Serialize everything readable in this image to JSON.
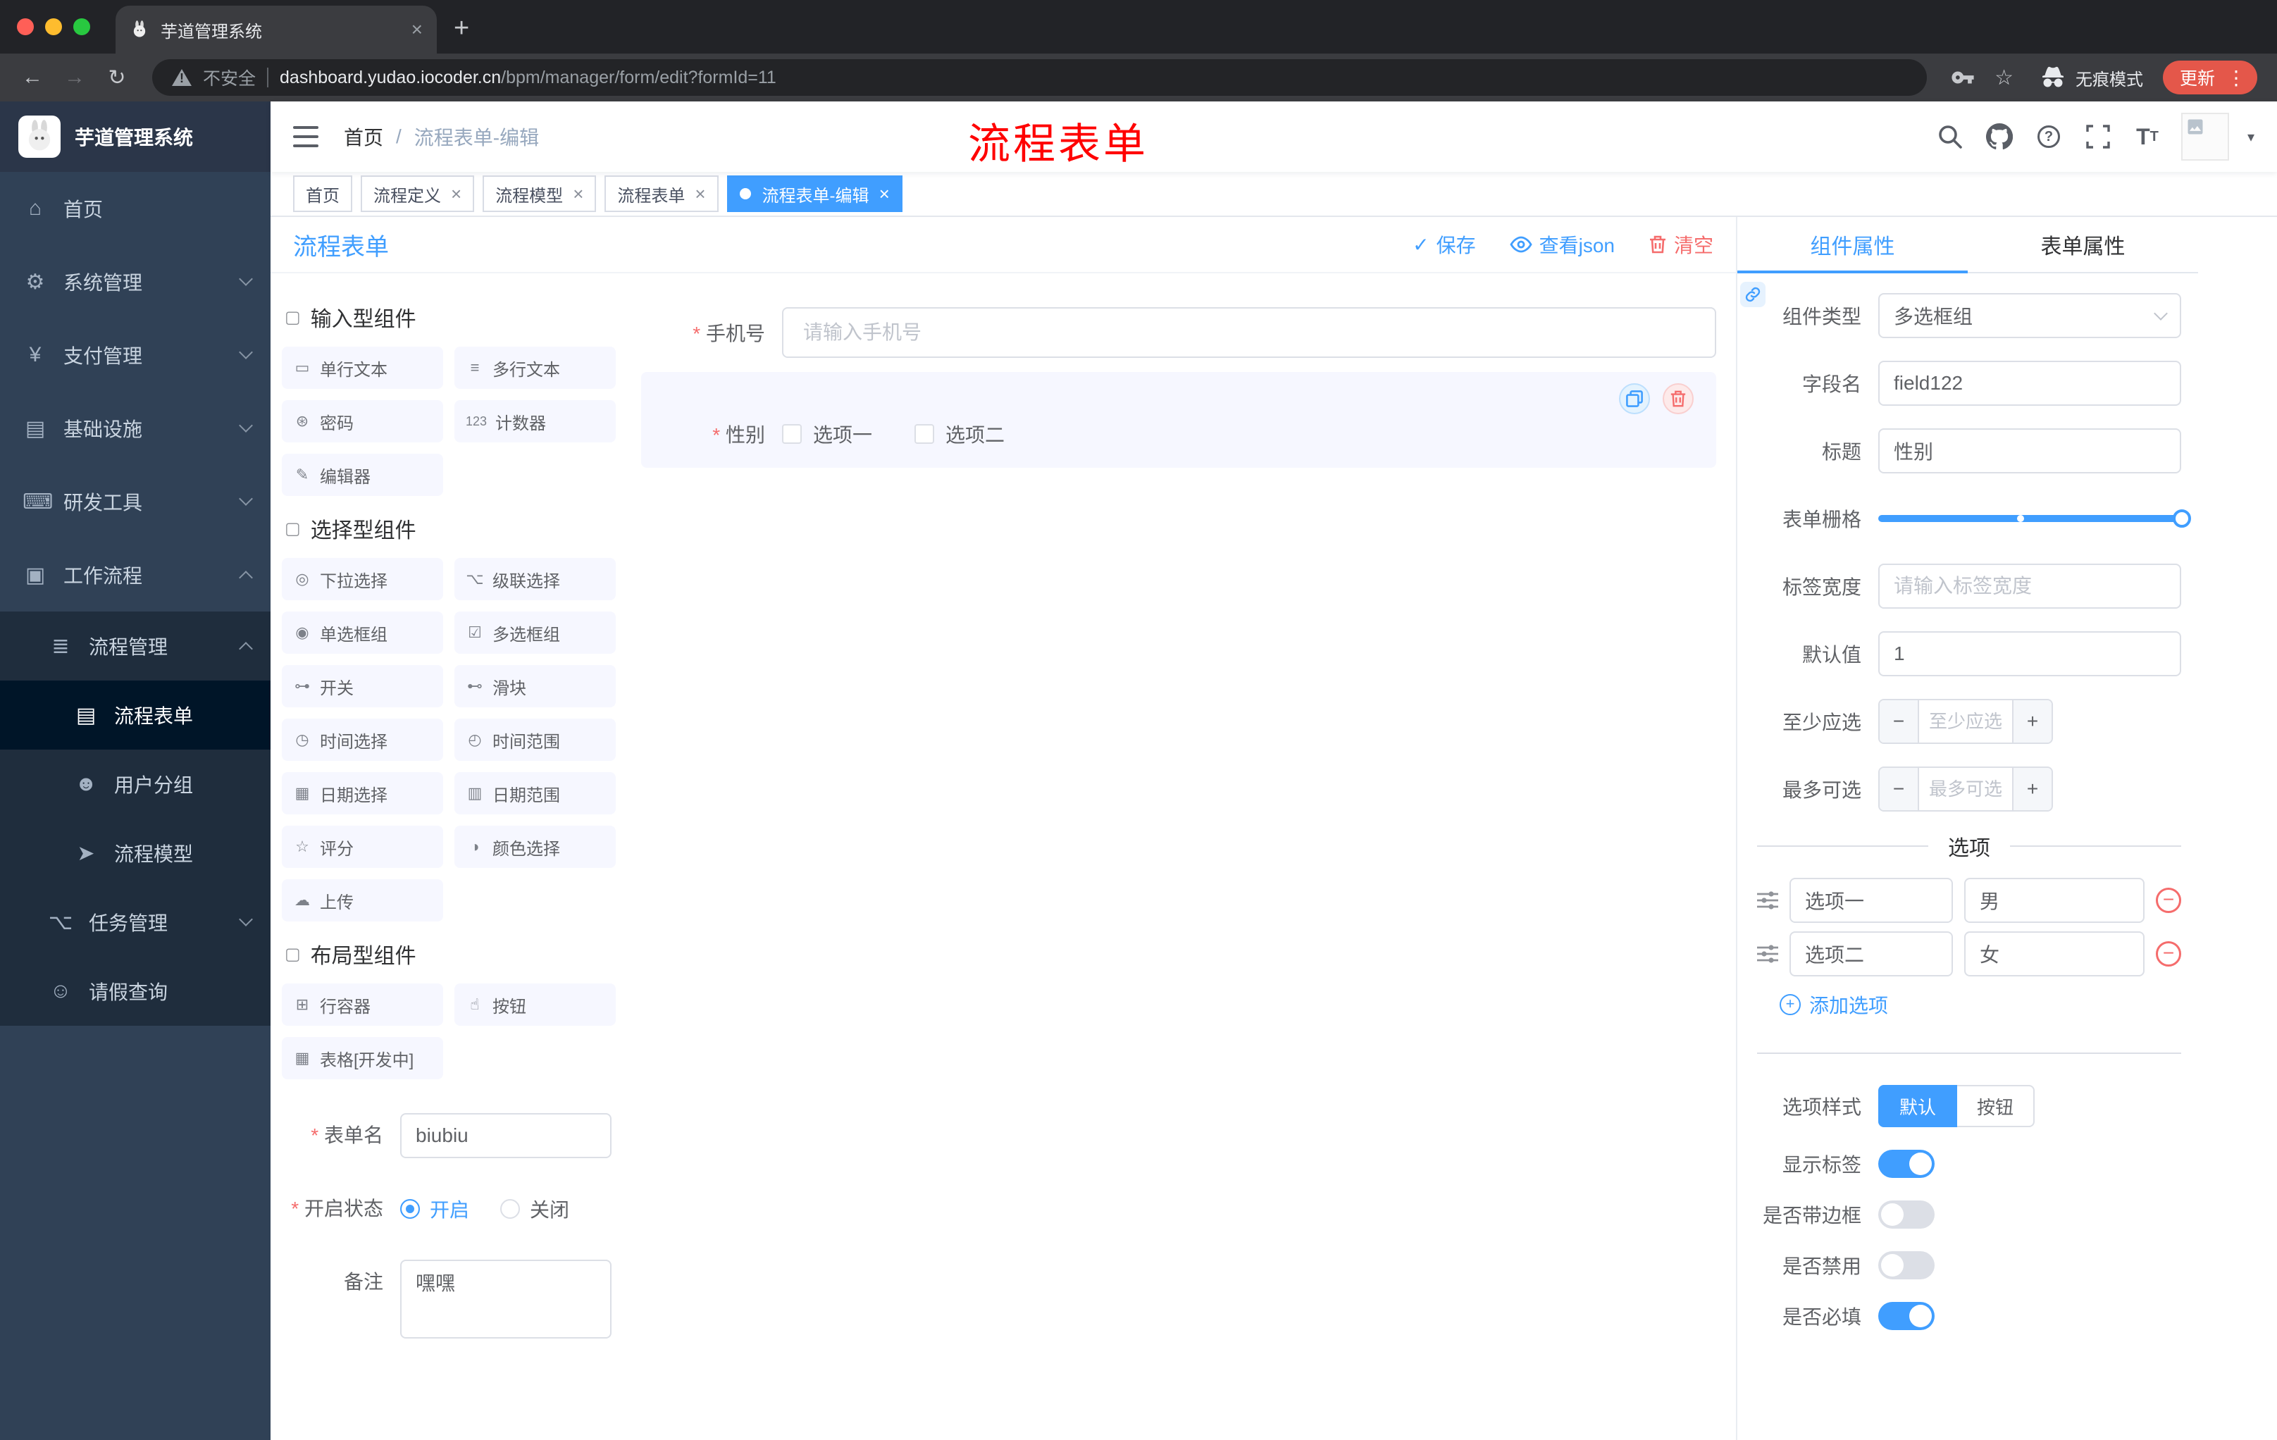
{
  "colors": {
    "accent": "#409eff",
    "danger": "#f56c6c",
    "sidebar_bg": "#304156",
    "submenu_bg": "#1f2d3d",
    "annotation": "#ff0000",
    "update_pill": "#e4574a",
    "active_tag": "#409eff"
  },
  "browser": {
    "tab_title": "芋道管理系统",
    "security_label": "不安全",
    "url_domain": "dashboard.yudao.iocoder.cn",
    "url_path": "/bpm/manager/form/edit?formId=11",
    "incognito_label": "无痕模式",
    "update_label": "更新"
  },
  "icons": {
    "home": "⌂",
    "system": "⚙",
    "payment": "¥",
    "infra": "▤",
    "devtools": "⌨",
    "workflow": "▣",
    "process_mgmt": "≣",
    "process_form": "▤",
    "user_group": "☻",
    "process_model": "➤",
    "task_mgmt": "⌥",
    "leave_query": "☺",
    "section": "▢"
  },
  "sidebar": {
    "logo_title": "芋道管理系统",
    "home": "首页",
    "system": "系统管理",
    "payment": "支付管理",
    "infra": "基础设施",
    "devtools": "研发工具",
    "workflow": "工作流程",
    "process_mgmt": "流程管理",
    "process_form": "流程表单",
    "user_group": "用户分组",
    "process_model": "流程模型",
    "task_mgmt": "任务管理",
    "leave_query": "请假查询"
  },
  "navbar": {
    "breadcrumb_home": "首页",
    "breadcrumb_current": "流程表单-编辑",
    "annotation": "流程表单"
  },
  "tags": {
    "items": [
      {
        "label": "首页"
      },
      {
        "label": "流程定义"
      },
      {
        "label": "流程模型"
      },
      {
        "label": "流程表单"
      },
      {
        "label": "流程表单-编辑"
      }
    ]
  },
  "designer": {
    "title": "流程表单",
    "save_label": "保存",
    "view_json_label": "查看json",
    "clear_label": "清空"
  },
  "palette": {
    "section_input": "输入型组件",
    "input_items": [
      {
        "icon": "▭",
        "label": "单行文本"
      },
      {
        "icon": "≡",
        "label": "多行文本"
      },
      {
        "icon": "⊛",
        "label": "密码"
      },
      {
        "icon": "123",
        "label": "计数器"
      },
      {
        "icon": "✎",
        "label": "编辑器"
      }
    ],
    "section_select": "选择型组件",
    "select_items": [
      {
        "icon": "◎",
        "label": "下拉选择"
      },
      {
        "icon": "⌥",
        "label": "级联选择"
      },
      {
        "icon": "◉",
        "label": "单选框组"
      },
      {
        "icon": "☑",
        "label": "多选框组"
      },
      {
        "icon": "⊶",
        "label": "开关"
      },
      {
        "icon": "⊷",
        "label": "滑块"
      },
      {
        "icon": "◷",
        "label": "时间选择"
      },
      {
        "icon": "◴",
        "label": "时间范围"
      },
      {
        "icon": "▦",
        "label": "日期选择"
      },
      {
        "icon": "▥",
        "label": "日期范围"
      },
      {
        "icon": "☆",
        "label": "评分"
      },
      {
        "icon": "◑",
        "label": "颜色选择"
      },
      {
        "icon": "☁",
        "label": "上传"
      }
    ],
    "section_layout": "布局型组件",
    "layout_items": [
      {
        "icon": "⊞",
        "label": "行容器"
      },
      {
        "icon": "☝",
        "label": "按钮"
      },
      {
        "icon": "▦",
        "label": "表格[开发中]"
      }
    ],
    "form_name_label": "表单名",
    "form_name_value": "biubiu",
    "status_label": "开启状态",
    "status_on": "开启",
    "status_off": "关闭",
    "remark_label": "备注",
    "remark_value": "嘿嘿"
  },
  "canvas": {
    "phone_label": "手机号",
    "phone_placeholder": "请输入手机号",
    "gender_label": "性别",
    "gender_opt1": "选项一",
    "gender_opt2": "选项二"
  },
  "props": {
    "tab_component": "组件属性",
    "tab_form": "表单属性",
    "type_label": "组件类型",
    "type_value": "多选框组",
    "field_label": "字段名",
    "field_value": "field122",
    "title_label": "标题",
    "title_value": "性别",
    "grid_label": "表单栅格",
    "label_width_label": "标签宽度",
    "label_width_placeholder": "请输入标签宽度",
    "default_label": "默认值",
    "default_value": "1",
    "min_label": "至少应选",
    "min_placeholder": "至少应选",
    "max_label": "最多可选",
    "max_placeholder": "最多可选",
    "options_title": "选项",
    "options": [
      {
        "label": "选项一",
        "value": "男"
      },
      {
        "label": "选项二",
        "value": "女"
      }
    ],
    "add_option_label": "添加选项",
    "style_label": "选项样式",
    "style_default": "默认",
    "style_button": "按钮",
    "show_label_label": "显示标签",
    "border_label": "是否带边框",
    "disabled_label": "是否禁用",
    "required_label": "是否必填"
  }
}
